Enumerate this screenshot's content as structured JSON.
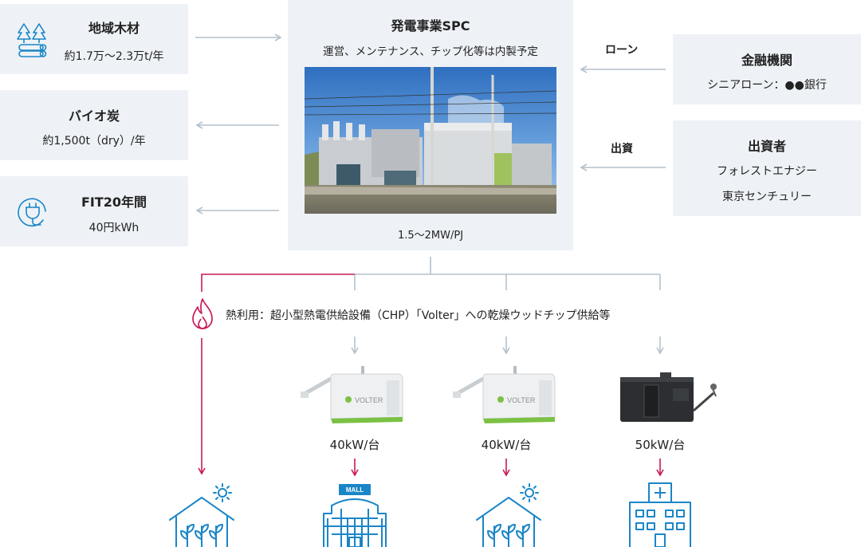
{
  "left_boxes": [
    {
      "title": "地域木材",
      "text": "約1.7万〜2.3万t/年",
      "icon": "timber-icon"
    },
    {
      "title": "バイオ炭",
      "text": "約1,500t（dry）/年",
      "icon": ""
    },
    {
      "title": "FIT20年間",
      "text": "40円kWh",
      "icon": "plug-icon"
    }
  ],
  "center": {
    "title": "発電事業SPC",
    "subtitle": "運営、メンテナンス、チップ化等は内製予定",
    "capacity": "1.5〜2MW/PJ",
    "photo": "power-plant-photo"
  },
  "right_boxes": [
    {
      "title": "金融機関",
      "lines": [
        "シニアローン：●●銀行"
      ],
      "arrow_label": "ローン"
    },
    {
      "title": "出資者",
      "lines": [
        "フォレストエナジー",
        "東京センチュリー"
      ],
      "arrow_label": "出資"
    }
  ],
  "heat_use": "熱利用：超小型熱電供給設備（CHP）「Volter」への乾燥ウッドチップ供給等",
  "units": [
    {
      "label": "40kW/台",
      "device": "volter-unit",
      "brand": "VOLTER"
    },
    {
      "label": "40kW/台",
      "device": "volter-unit",
      "brand": "VOLTER"
    },
    {
      "label": "50kW/台",
      "device": "dark-chp-unit",
      "brand": ""
    }
  ],
  "destinations": [
    {
      "icon": "greenhouse-icon"
    },
    {
      "icon": "mall-icon",
      "sign": "MALL"
    },
    {
      "icon": "greenhouse-icon"
    },
    {
      "icon": "hospital-icon"
    }
  ],
  "colors": {
    "box_bg": "#eef2f6",
    "arrow_gray": "#b4c1cc",
    "accent": "#c8195a",
    "icon_blue": "#1a86c7",
    "volter_green": "#7bc143"
  }
}
